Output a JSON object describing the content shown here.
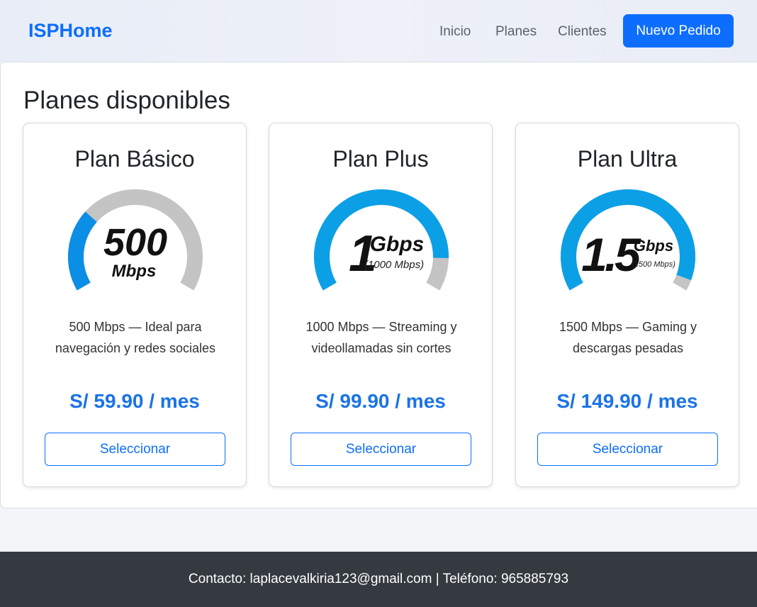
{
  "nav": {
    "brand": "ISPHome",
    "links": [
      "Inicio",
      "Planes",
      "Clientes"
    ],
    "cta": "Nuevo Pedido"
  },
  "main": {
    "title": "Planes disponibles"
  },
  "plans": [
    {
      "name": "Plan Básico",
      "gauge_big": "500",
      "gauge_unit": "Mbps",
      "gauge_sub": "",
      "gauge_level": 0.3,
      "gauge_color": "#0b8ee6",
      "description": "500 Mbps — Ideal para navegación y redes sociales",
      "price": "S/ 59.90 / mes",
      "button": "Seleccionar"
    },
    {
      "name": "Plan Plus",
      "gauge_big": "1",
      "gauge_unit": "Gbps",
      "gauge_sub": "(1000 Mbps)",
      "gauge_level": 0.88,
      "gauge_color": "#0b9fe6",
      "description": "1000 Mbps — Streaming y videollamadas sin cortes",
      "price": "S/ 99.90 / mes",
      "button": "Seleccionar"
    },
    {
      "name": "Plan Ultra",
      "gauge_big": "1.5",
      "gauge_unit": "Gbps",
      "gauge_sub": "(1500 Mbps)",
      "gauge_level": 0.96,
      "gauge_color": "#0b9fe6",
      "description": "1500 Mbps — Gaming y descargas pesadas",
      "price": "S/ 149.90 / mes",
      "button": "Seleccionar"
    }
  ],
  "footer": {
    "contact": "Contacto: laplacevalkiria123@gmail.com | Teléfono: 965885793"
  }
}
